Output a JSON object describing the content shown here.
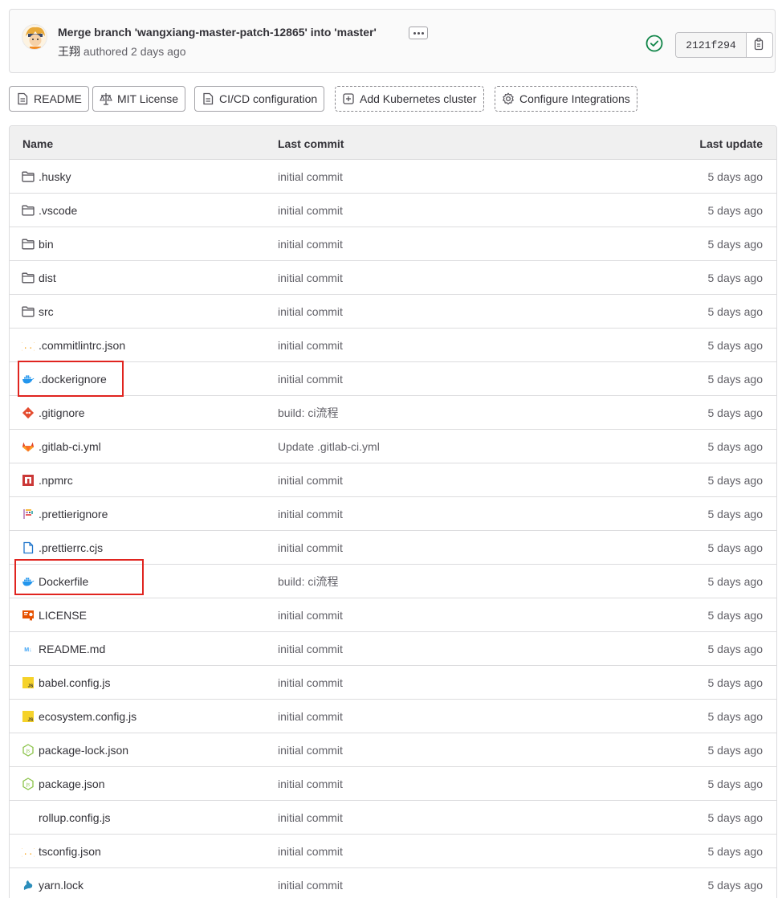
{
  "commit": {
    "title": "Merge branch 'wangxiang-master-patch-12865' into 'master'",
    "author": "王翔",
    "authored_text": "authored 2 days ago",
    "sha": "2121f294",
    "status": "passed"
  },
  "project_buttons": [
    {
      "label": "README",
      "icon": "file-icon",
      "style": "solid"
    },
    {
      "label": "MIT License",
      "icon": "scale-icon",
      "style": "solid"
    },
    {
      "label": "CI/CD configuration",
      "icon": "file-icon",
      "style": "solid"
    },
    {
      "label": "Add Kubernetes cluster",
      "icon": "plus-square-icon",
      "style": "dashed"
    },
    {
      "label": "Configure Integrations",
      "icon": "gear-icon",
      "style": "dashed"
    }
  ],
  "table": {
    "headers": {
      "name": "Name",
      "last_commit": "Last commit",
      "last_update": "Last update"
    },
    "rows": [
      {
        "name": ".husky",
        "icon": "folder-icon",
        "commit": "initial commit",
        "date": "5 days ago"
      },
      {
        "name": ".vscode",
        "icon": "folder-icon",
        "commit": "initial commit",
        "date": "5 days ago"
      },
      {
        "name": "bin",
        "icon": "folder-icon",
        "commit": "initial commit",
        "date": "5 days ago"
      },
      {
        "name": "dist",
        "icon": "folder-icon",
        "commit": "initial commit",
        "date": "5 days ago"
      },
      {
        "name": "src",
        "icon": "folder-icon",
        "commit": "initial commit",
        "date": "5 days ago"
      },
      {
        "name": ".commitlintrc.json",
        "icon": "json-icon",
        "commit": "initial commit",
        "date": "5 days ago"
      },
      {
        "name": ".dockerignore",
        "icon": "docker-icon",
        "commit": "initial commit",
        "date": "5 days ago"
      },
      {
        "name": ".gitignore",
        "icon": "git-icon",
        "commit": "build: ci流程",
        "date": "5 days ago"
      },
      {
        "name": ".gitlab-ci.yml",
        "icon": "gitlab-icon",
        "commit": "Update .gitlab-ci.yml",
        "date": "5 days ago"
      },
      {
        "name": ".npmrc",
        "icon": "npm-icon",
        "commit": "initial commit",
        "date": "5 days ago"
      },
      {
        "name": ".prettierignore",
        "icon": "prettier-icon",
        "commit": "initial commit",
        "date": "5 days ago"
      },
      {
        "name": ".prettierrc.cjs",
        "icon": "file-blue-icon",
        "commit": "initial commit",
        "date": "5 days ago"
      },
      {
        "name": "Dockerfile",
        "icon": "docker-icon",
        "commit": "build: ci流程",
        "date": "5 days ago"
      },
      {
        "name": "LICENSE",
        "icon": "license-icon",
        "commit": "initial commit",
        "date": "5 days ago"
      },
      {
        "name": "README.md",
        "icon": "markdown-icon",
        "commit": "initial commit",
        "date": "5 days ago"
      },
      {
        "name": "babel.config.js",
        "icon": "js-icon",
        "commit": "initial commit",
        "date": "5 days ago"
      },
      {
        "name": "ecosystem.config.js",
        "icon": "js-icon",
        "commit": "initial commit",
        "date": "5 days ago"
      },
      {
        "name": "package-lock.json",
        "icon": "node-icon",
        "commit": "initial commit",
        "date": "5 days ago"
      },
      {
        "name": "package.json",
        "icon": "node-icon",
        "commit": "initial commit",
        "date": "5 days ago"
      },
      {
        "name": "rollup.config.js",
        "icon": "none",
        "commit": "initial commit",
        "date": "5 days ago"
      },
      {
        "name": "tsconfig.json",
        "icon": "json-icon",
        "commit": "initial commit",
        "date": "5 days ago"
      },
      {
        "name": "yarn.lock",
        "icon": "yarn-icon",
        "commit": "initial commit",
        "date": "5 days ago"
      }
    ]
  },
  "colors": {
    "highlight": "#e0241f",
    "success": "#108548",
    "link": "#333238"
  }
}
